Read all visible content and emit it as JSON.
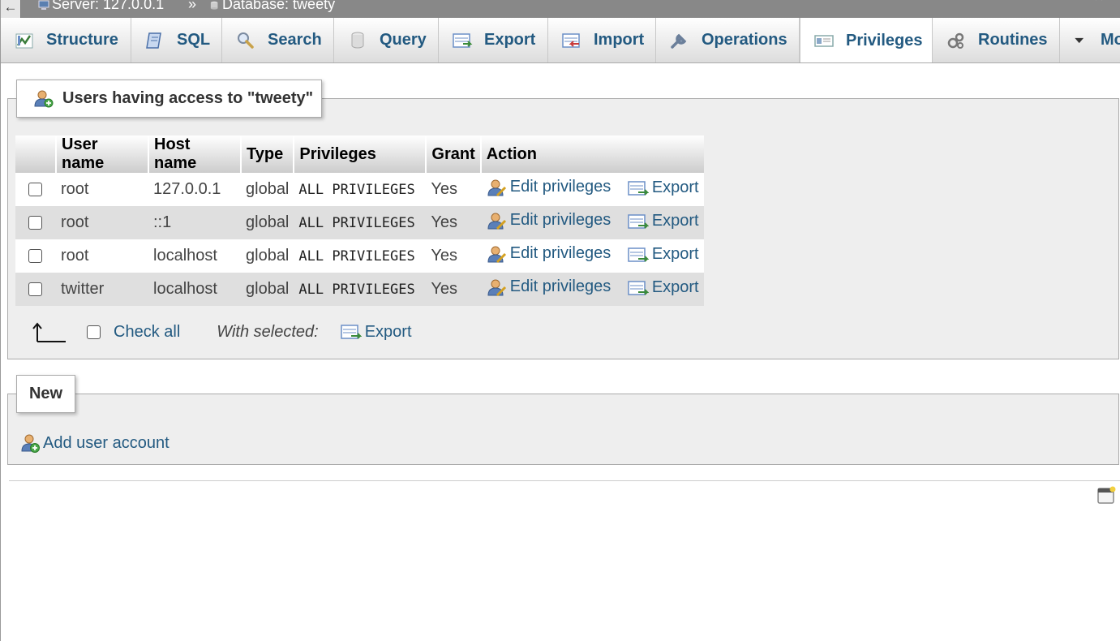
{
  "breadcrumb": {
    "back_arrow": "←",
    "server": "Server: 127.0.0.1",
    "separator": "»",
    "database": "Database: tweety",
    "collapse_glyph": "⌃"
  },
  "tabs": [
    {
      "label": "Structure",
      "icon": "structure-icon"
    },
    {
      "label": "SQL",
      "icon": "sql-icon"
    },
    {
      "label": "Search",
      "icon": "search-icon"
    },
    {
      "label": "Query",
      "icon": "query-icon"
    },
    {
      "label": "Export",
      "icon": "export-icon"
    },
    {
      "label": "Import",
      "icon": "import-icon"
    },
    {
      "label": "Operations",
      "icon": "wrench-icon"
    },
    {
      "label": "Privileges",
      "icon": "privileges-icon",
      "active": true
    },
    {
      "label": "Routines",
      "icon": "routines-icon"
    },
    {
      "label": "Mo",
      "icon": "chevron-down-icon"
    }
  ],
  "users_section": {
    "legend": "Users having access to \"tweety\"",
    "columns": [
      "User name",
      "Host name",
      "Type",
      "Privileges",
      "Grant",
      "Action"
    ],
    "rows": [
      {
        "user": "root",
        "host": "127.0.0.1",
        "type": "global",
        "privileges": "ALL PRIVILEGES",
        "grant": "Yes",
        "edit": "Edit privileges",
        "export": "Export"
      },
      {
        "user": "root",
        "host": "::1",
        "type": "global",
        "privileges": "ALL PRIVILEGES",
        "grant": "Yes",
        "edit": "Edit privileges",
        "export": "Export"
      },
      {
        "user": "root",
        "host": "localhost",
        "type": "global",
        "privileges": "ALL PRIVILEGES",
        "grant": "Yes",
        "edit": "Edit privileges",
        "export": "Export"
      },
      {
        "user": "twitter",
        "host": "localhost",
        "type": "global",
        "privileges": "ALL PRIVILEGES",
        "grant": "Yes",
        "edit": "Edit privileges",
        "export": "Export"
      }
    ],
    "check_all": "Check all",
    "with_selected": "With selected:",
    "bulk_export": "Export"
  },
  "new_section": {
    "legend": "New",
    "add_user": "Add user account"
  },
  "colors": {
    "link": "#235a81",
    "topbar": "#888888",
    "panel": "#eeeeee",
    "row_alt": "#dfdfdf"
  }
}
